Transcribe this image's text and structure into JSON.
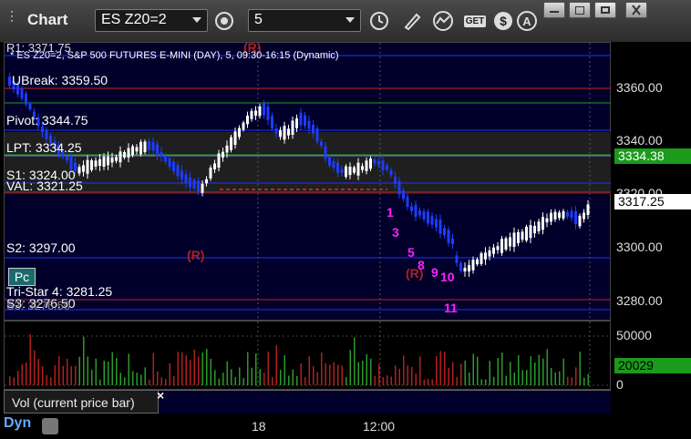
{
  "window": {
    "title": "Chart",
    "symbol": "ES Z20=2",
    "interval": "5",
    "buttons": [
      "minimize",
      "restore-down",
      "maximize",
      "close"
    ]
  },
  "toolbar": {
    "icons": [
      "gear-icon",
      "clock-icon",
      "pencil-icon",
      "line-study-icon",
      "get-icon",
      "dollar-icon",
      "a-icon"
    ],
    "get_label": "GET"
  },
  "chart": {
    "header": "* ES Z20=2, S&P 500 FUTURES E-MINI (DAY), 5, 09:30-16:15 (Dynamic)",
    "price_axis": [
      "3360.00",
      "3340.00",
      "3320.00",
      "3300.00",
      "3280.00"
    ],
    "last_price": "3334.38",
    "current_price": "3317.25",
    "levels": {
      "r1": "R1: 3371.75",
      "upper_break": "UBreak: 3359.50",
      "pivot": "Pivot: 3344.75",
      "lpt": "LPT: 3334.25",
      "s1": "S1: 3324.00",
      "val": "VAL: 3321.25",
      "s2": "S2: 3297.00",
      "tri_star": "Tri-Star 4: 3281.25",
      "s3": "S3: 3276.50",
      "partial": "S3: 3276.50"
    },
    "markers": {
      "r": "(R)",
      "pc": "Pc",
      "count_numbers": [
        "1",
        "3",
        "5",
        "8",
        "9",
        "10",
        "11"
      ]
    },
    "time_axis": [
      "18",
      "12:00"
    ]
  },
  "volume": {
    "axis": [
      "50000",
      "0"
    ],
    "value": "20029",
    "panel_label": "Vol (current price bar)",
    "close_label": "×"
  },
  "footer": {
    "mode": "Dyn"
  },
  "colors": {
    "up_bar": "#ffffff",
    "down_bar": "#1e3cff",
    "support": "#2030ff",
    "resistance": "#cc2020",
    "green_line": "#1a9f1a",
    "count": "#ff20ff",
    "vol_up": "#2a9a2a",
    "vol_down": "#b02020"
  }
}
